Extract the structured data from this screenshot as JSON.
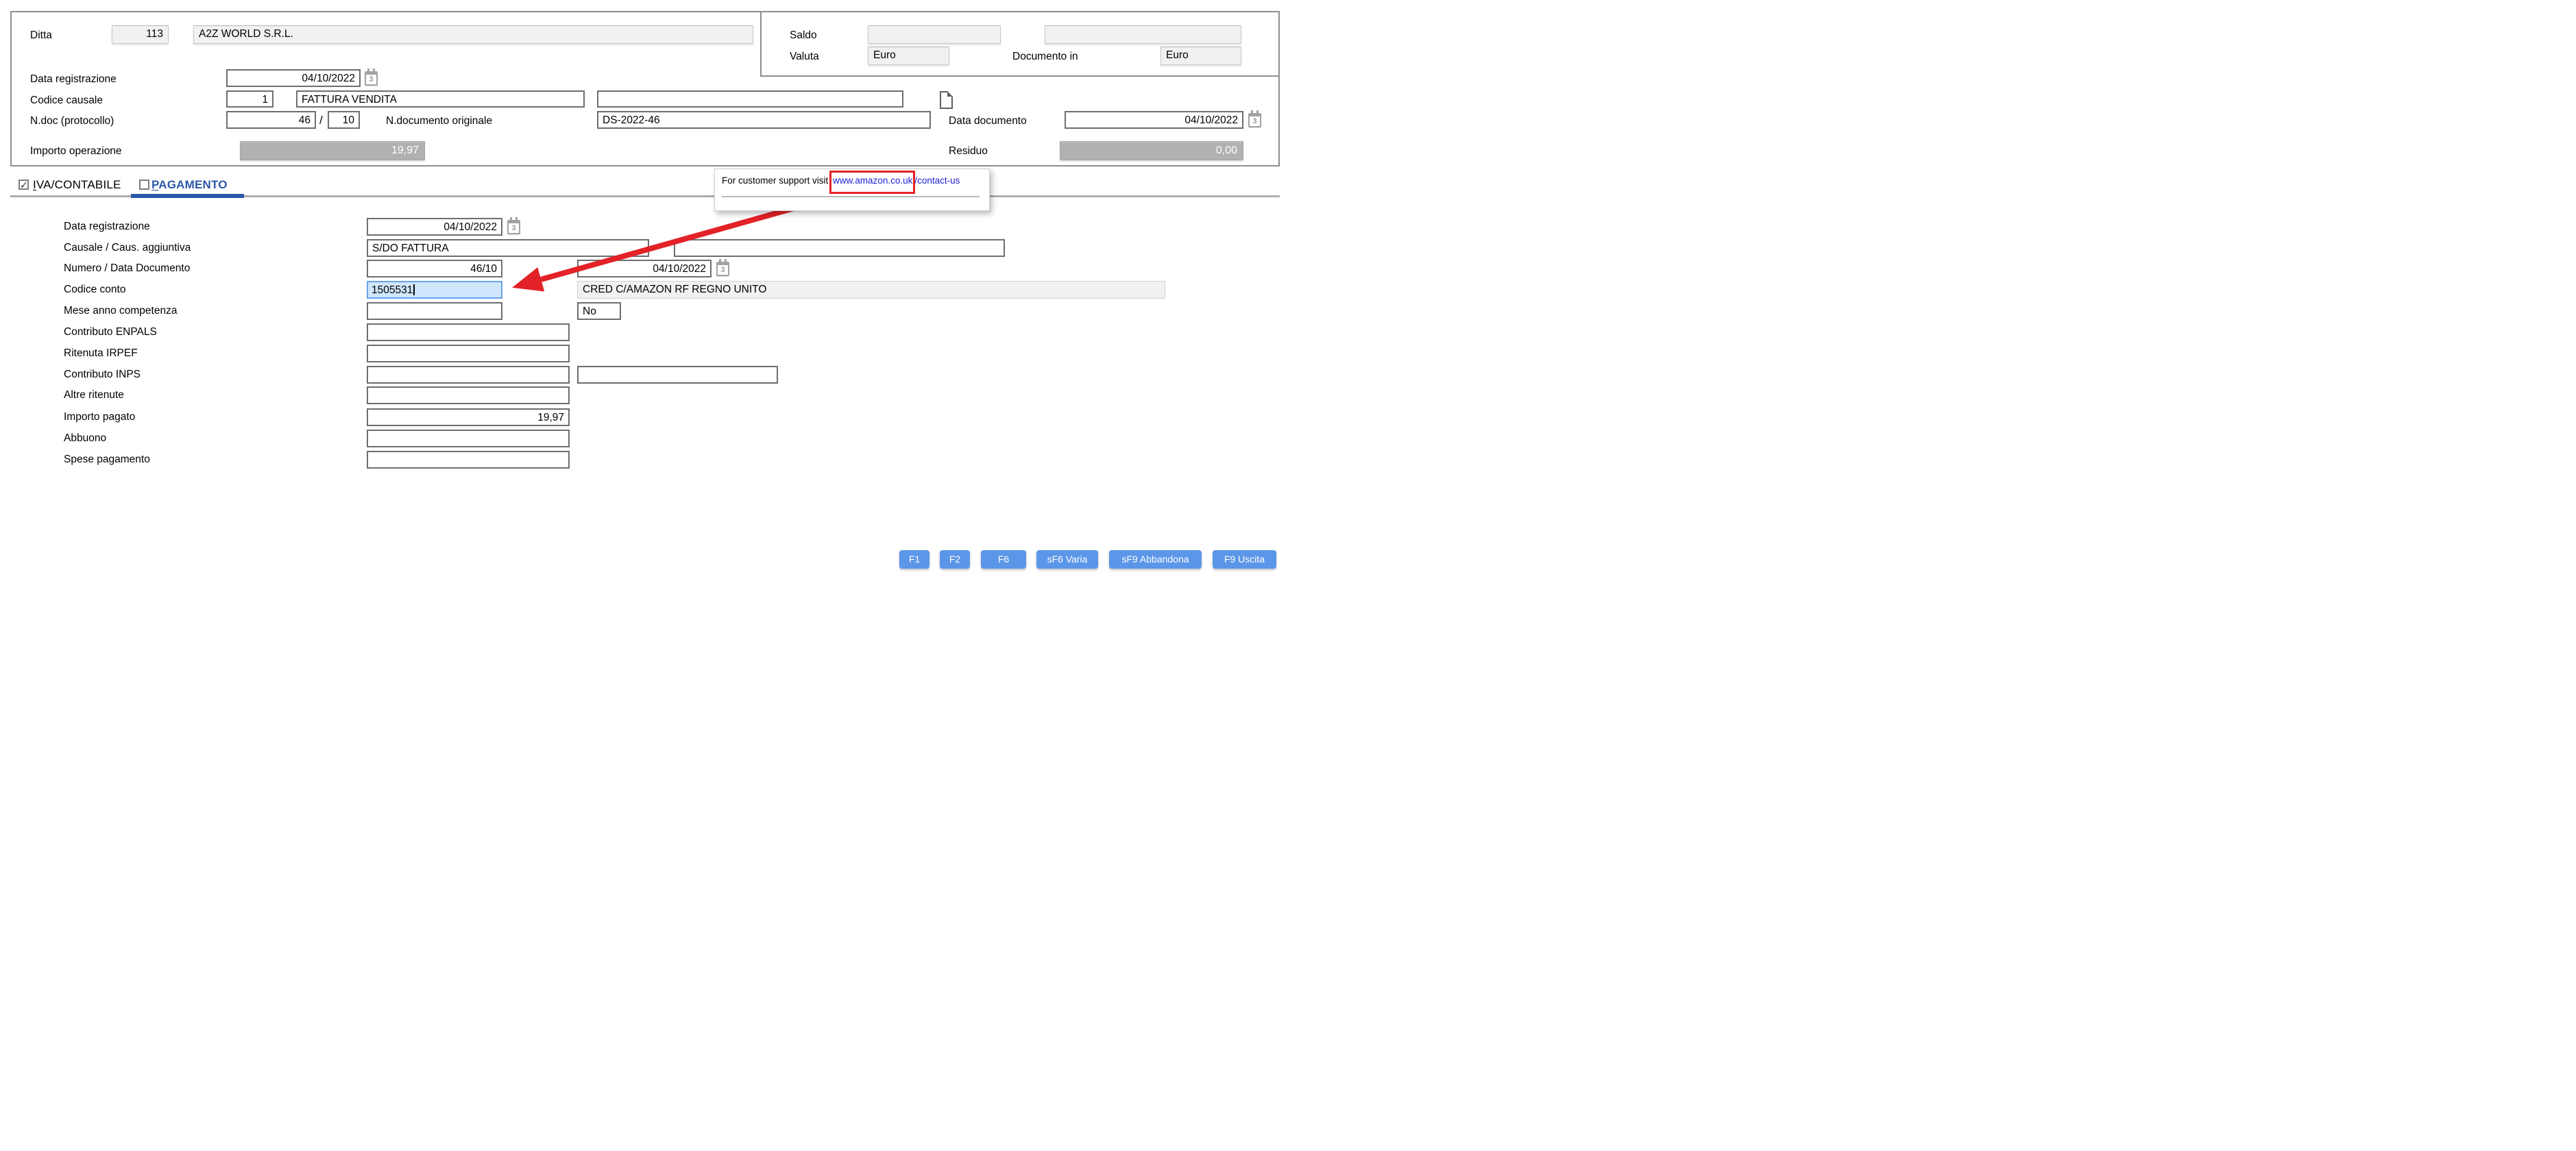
{
  "header": {
    "ditta": {
      "label": "Ditta",
      "code": "113",
      "name": "A2Z WORLD S.R.L."
    },
    "saldo": {
      "label": "Saldo",
      "value1": "",
      "value2": ""
    },
    "valuta": {
      "label": "Valuta",
      "value": "Euro"
    },
    "documento_in": {
      "label": "Documento in",
      "value": "Euro"
    },
    "data_registrazione": {
      "label": "Data registrazione",
      "value": "04/10/2022"
    },
    "codice_causale": {
      "label": "Codice causale",
      "code": "1",
      "description": "FATTURA VENDITA",
      "extra": ""
    },
    "ndoc": {
      "label": "N.doc (protocollo)",
      "number": "46",
      "separator": "/",
      "suffix": "10"
    },
    "ndoc_originale": {
      "label": "N.documento originale",
      "value": "DS-2022-46"
    },
    "data_documento": {
      "label": "Data documento",
      "value": "04/10/2022"
    },
    "importo_operazione": {
      "label": "Importo operazione",
      "value": "19,97"
    },
    "residuo": {
      "label": "Residuo",
      "value": "0,00"
    }
  },
  "tabs": {
    "iva": {
      "access": "I",
      "rest": "VA/CONTABILE"
    },
    "pagamento": {
      "access": "P",
      "rest": "AGAMENTO"
    }
  },
  "tooltip": {
    "prefix": "For customer support visit ",
    "link_boxed": "www.amazon.co.uk",
    "link_rest": "/contact-us"
  },
  "form": {
    "data_registrazione": {
      "label": "Data registrazione",
      "value": "04/10/2022"
    },
    "causale": {
      "label": "Causale / Caus. aggiuntiva",
      "value": "S/DO FATTURA",
      "extra": ""
    },
    "numero_data": {
      "label": "Numero / Data Documento",
      "value": "46/10",
      "date": "04/10/2022"
    },
    "codice_conto": {
      "label": "Codice conto",
      "value": "1505531",
      "description": "CRED C/AMAZON RF REGNO UNITO"
    },
    "mese_anno": {
      "label": "Mese anno competenza",
      "value": "",
      "flag": "No"
    },
    "contributo_enpals": {
      "label": "Contributo ENPALS",
      "value": ""
    },
    "ritenuta_irpef": {
      "label": "Ritenuta IRPEF",
      "value": ""
    },
    "contributo_inps": {
      "label": "Contributo INPS",
      "value": "",
      "extra": ""
    },
    "altre_ritenute": {
      "label": "Altre ritenute",
      "value": ""
    },
    "importo_pagato": {
      "label": "Importo pagato",
      "value": "19,97"
    },
    "abbuono": {
      "label": "Abbuono",
      "value": ""
    },
    "spese_pagamento": {
      "label": "Spese pagamento",
      "value": ""
    }
  },
  "icons": {
    "calendar_glyph": "3",
    "checkmark": "✓"
  },
  "footer": {
    "buttons": [
      "F1",
      "F2",
      "F6",
      "sF6 Varia",
      "sF9 Abbandona",
      "F9 Uscita"
    ]
  },
  "colors": {
    "accent_blue": "#2b57a7",
    "button_blue": "#5c96e8",
    "annotation_red": "#e32227",
    "focus_field_bg": "#cfe6fd",
    "link_blue": "#1f1fd4",
    "money_field_bg": "#b1b1b1"
  }
}
